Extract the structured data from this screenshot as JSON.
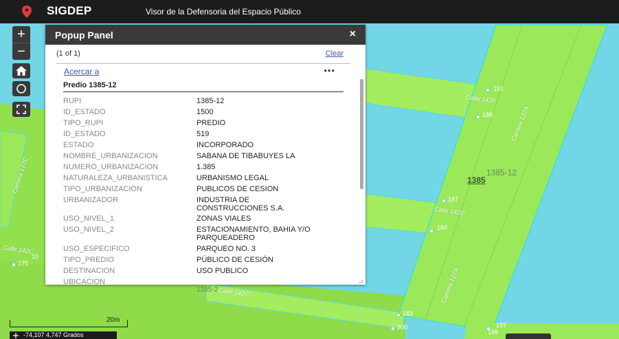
{
  "header": {
    "title": "SIGDEP",
    "subtitle": "Visor de la Defensoria del Espacio Público"
  },
  "map_controls": {
    "zoom_in": "+",
    "zoom_out": "−"
  },
  "popup": {
    "title": "Popup Panel",
    "close": "×",
    "count": "(1 of 1)",
    "clear": "Clear",
    "zoom_to": "Acercar a",
    "more": "•••",
    "feature_title": "Predio 1385-12",
    "attributes": [
      {
        "key": "RUPI",
        "value": "1385-12"
      },
      {
        "key": "ID_ESTADO",
        "value": "1500"
      },
      {
        "key": "TIPO_RUPI",
        "value": "PREDIO"
      },
      {
        "key": "ID_ESTADO",
        "value": "519"
      },
      {
        "key": "ESTADO",
        "value": "INCORPORADO"
      },
      {
        "key": "NOMBRE_URBANIZACION",
        "value": "SABANA DE TIBABUYES LA"
      },
      {
        "key": "NUMERO_URBANIZACION",
        "value": "1.385"
      },
      {
        "key": "NATURALEZA_URBANISTICA",
        "value": "URBANISMO LEGAL"
      },
      {
        "key": "TIPO_URBANIZACION",
        "value": "PUBLICOS DE CESION"
      },
      {
        "key": "URBANIZADOR",
        "value": "INDUSTRIA DE CONSTRUCCIONES S.A."
      },
      {
        "key": "USO_NIVEL_1",
        "value": "ZONAS VIALES"
      },
      {
        "key": "USO_NIVEL_2",
        "value": "ESTACIONAMIENTO, BAHIA Y/O PARQUEADERO"
      },
      {
        "key": "USO_ESPECIFICO",
        "value": "PARQUEO NO. 3"
      },
      {
        "key": "TIPO_PREDIO",
        "value": "PÚBLICO DE CESIÓN"
      },
      {
        "key": "DESTINACION",
        "value": "USO PUBLICO"
      },
      {
        "key": "UBICACION",
        "value": ""
      }
    ]
  },
  "map_labels": {
    "street_1": "Calle 142F",
    "street_2": "Calle 142D",
    "street_3": "Calle 142C",
    "street_4": "Calle 142C",
    "carrera_1": "Carrera 127A",
    "carrera_2": "Carrera 127A",
    "carrera_3": "Carrera 127C",
    "lot_label": "1385-12",
    "lot_label_bold": "1385",
    "lot_bottom": "1385-2",
    "n191": "191",
    "n188": "188",
    "n187": "187",
    "n184": "184",
    "n183": "183",
    "n200": "200",
    "n197": "197",
    "n198": "198",
    "n175": "175",
    "n10": "10"
  },
  "footer": {
    "coords": "-74,107 4,747 Grados",
    "scale": "20m"
  },
  "colors": {
    "water": "#72d6e6",
    "parcel": "#9be85a",
    "road_strip": "#a8ef66",
    "outline": "#5ad8d0",
    "header": "#1c1c1c",
    "link": "#3a56a8"
  }
}
